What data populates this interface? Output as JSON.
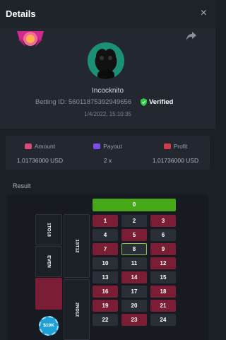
{
  "header": {
    "title": "Details",
    "close_symbol": "×"
  },
  "profile": {
    "username": "Incocknito",
    "betting_id_label": "Betting ID:",
    "betting_id": "560118753929496​56",
    "verified_label": "Verified",
    "datetime": "1/4/2022, 15:10:35"
  },
  "stats": {
    "amount_label": "Amount",
    "amount_value": "1.01736000 USD",
    "payout_label": "Payout",
    "payout_value": "2 x",
    "profit_label": "Profit",
    "profit_value": "1.01736000 USD"
  },
  "result": {
    "label": "Result",
    "zero": "0",
    "outside": {
      "low": "1TO18",
      "even": "EVEN",
      "first_12": "1ST12",
      "second_12": "2ND12"
    },
    "chip": "$10K",
    "numbers": [
      "1",
      "2",
      "3",
      "4",
      "5",
      "6",
      "7",
      "8",
      "9",
      "10",
      "11",
      "12",
      "13",
      "14",
      "15",
      "16",
      "17",
      "18",
      "19",
      "20",
      "21",
      "22",
      "23",
      "24"
    ]
  },
  "colors": {
    "accent_green": "#47a817",
    "red": "#7a1d35",
    "verified": "#2ecc40"
  }
}
